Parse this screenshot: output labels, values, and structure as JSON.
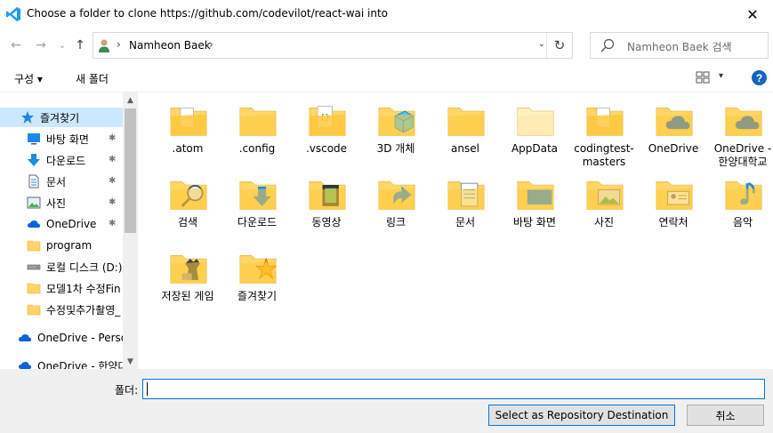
{
  "window": {
    "title": "Choose a folder to clone https://github.com/codevilot/react-wai into",
    "close_glyph": "✕",
    "app_icon": "vscode-icon"
  },
  "nav": {
    "back_glyph": "←",
    "forward_glyph": "→",
    "recent_glyph": "⌄",
    "up_glyph": "↑",
    "breadcrumb_sep": "›",
    "breadcrumb": "Namheon Baek",
    "trailing_sep": "›",
    "dropdown_glyph": "⌄",
    "refresh_glyph": "↻",
    "search_placeholder": "Namheon Baek 검색"
  },
  "toolbar": {
    "organize_label": "구성 ▾",
    "new_folder_label": "새 폴더",
    "view_dropdown": "▾",
    "help_glyph": "?"
  },
  "sidebar": {
    "items": [
      {
        "label": "즐겨찾기",
        "icon": "star-icon",
        "selected": true,
        "pinned": false
      },
      {
        "label": "바탕 화면",
        "icon": "desktop-icon",
        "pinned": true
      },
      {
        "label": "다운로드",
        "icon": "download-icon",
        "pinned": true
      },
      {
        "label": "문서",
        "icon": "document-icon",
        "pinned": true
      },
      {
        "label": "사진",
        "icon": "pictures-icon",
        "pinned": true
      },
      {
        "label": "OneDrive",
        "icon": "cloud-icon",
        "pinned": true
      },
      {
        "label": "program",
        "icon": "folder-icon",
        "pinned": false
      },
      {
        "label": "로컬 디스크 (D:)",
        "icon": "drive-icon",
        "pinned": false
      },
      {
        "label": "모델1차 수정Fin",
        "icon": "folder-icon",
        "pinned": false
      },
      {
        "label": "수정및추가촬영_",
        "icon": "folder-icon",
        "pinned": false
      },
      {
        "label": "OneDrive - Personal",
        "icon": "cloud-icon",
        "pinned": false
      },
      {
        "label": "OneDrive - 한양대",
        "icon": "cloud-icon",
        "pinned": false
      }
    ],
    "pin_glyph": "📌",
    "scroll_up": "▲",
    "scroll_down": "▼"
  },
  "folders": [
    {
      "label": ".atom",
      "icon": "folder-doc-icon"
    },
    {
      "label": ".config",
      "icon": "folder-icon"
    },
    {
      "label": ".vscode",
      "icon": "folder-code-icon"
    },
    {
      "label": "3D 개체",
      "icon": "3d-objects-icon"
    },
    {
      "label": "ansel",
      "icon": "folder-icon"
    },
    {
      "label": "AppData",
      "icon": "folder-hidden-icon"
    },
    {
      "label": "codingtest-masters",
      "icon": "folder-doc-icon"
    },
    {
      "label": "OneDrive",
      "icon": "onedrive-folder-icon"
    },
    {
      "label": "OneDrive - 한양대학교",
      "icon": "onedrive-folder-icon"
    },
    {
      "label": "검색",
      "icon": "search-folder-icon"
    },
    {
      "label": "다운로드",
      "icon": "downloads-folder-icon"
    },
    {
      "label": "동영상",
      "icon": "videos-folder-icon"
    },
    {
      "label": "링크",
      "icon": "links-folder-icon"
    },
    {
      "label": "문서",
      "icon": "documents-folder-icon"
    },
    {
      "label": "바탕 화면",
      "icon": "desktop-folder-icon"
    },
    {
      "label": "사진",
      "icon": "pictures-folder-icon"
    },
    {
      "label": "연락처",
      "icon": "contacts-folder-icon"
    },
    {
      "label": "음악",
      "icon": "music-folder-icon"
    },
    {
      "label": "저장된 게임",
      "icon": "saved-games-folder-icon"
    },
    {
      "label": "즐겨찾기",
      "icon": "favorites-folder-icon"
    }
  ],
  "bottom": {
    "folder_label": "폴더:",
    "folder_value": "",
    "select_button": "Select as Repository Destination",
    "cancel_button": "취소"
  },
  "colors": {
    "accent": "#0078d7",
    "folder_yellow": "#ffd766",
    "selected_bg": "#cce8ff"
  }
}
